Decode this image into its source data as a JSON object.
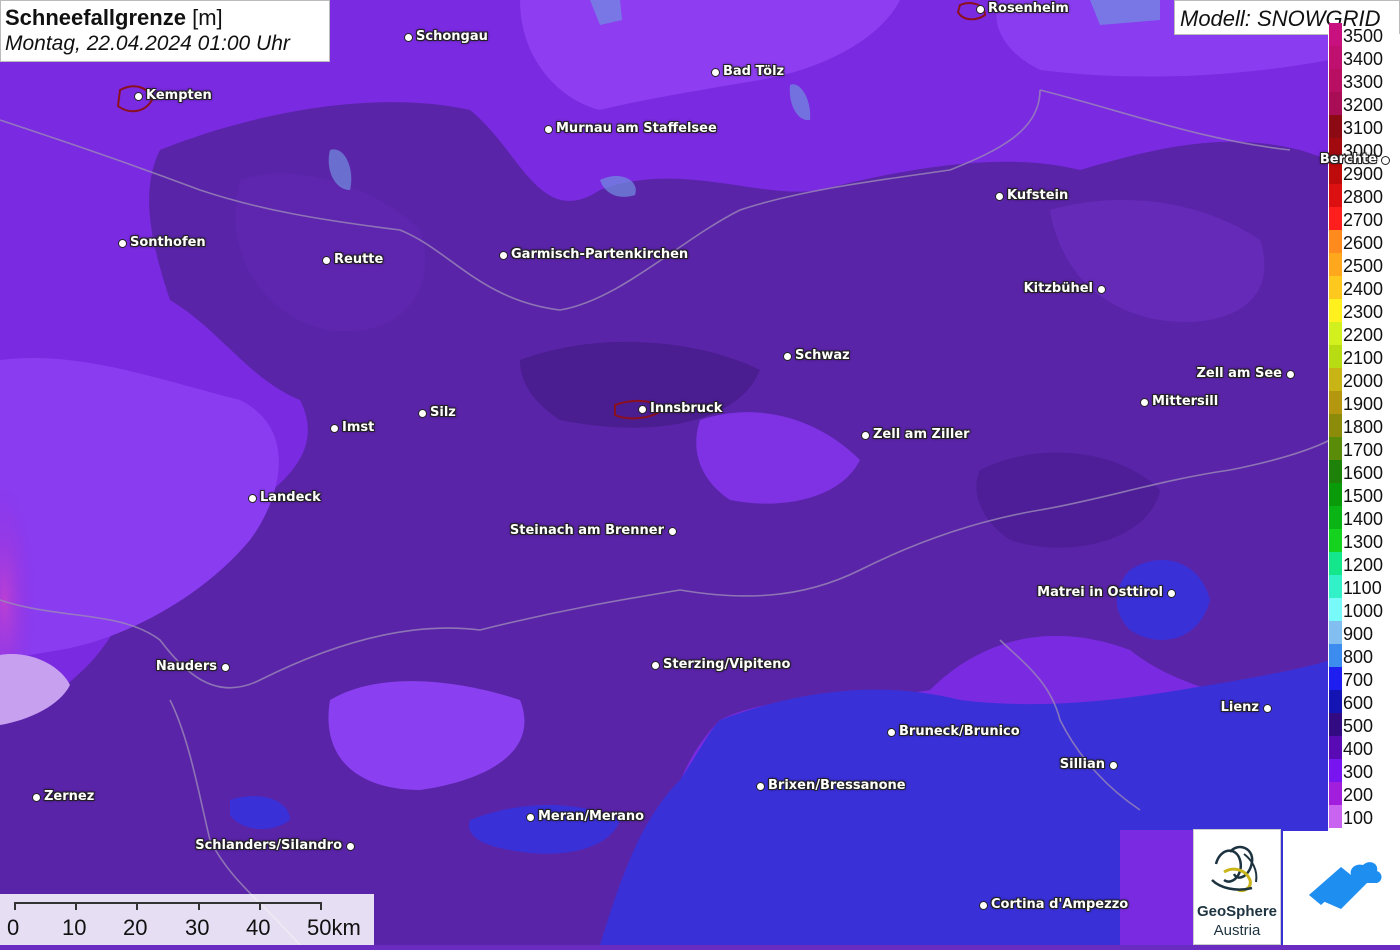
{
  "title": {
    "variable": "Schneefallgrenze",
    "unit": "[m]",
    "datetime": "Montag, 22.04.2024 01:00 Uhr"
  },
  "model": {
    "label": "Modell: SNOWGRID"
  },
  "legend": [
    {
      "value": "3500",
      "color": "#c8107e"
    },
    {
      "value": "3400",
      "color": "#c0106f"
    },
    {
      "value": "3300",
      "color": "#b80f62"
    },
    {
      "value": "3200",
      "color": "#a80d55"
    },
    {
      "value": "3100",
      "color": "#8c0a14"
    },
    {
      "value": "3000",
      "color": "#a20a10"
    },
    {
      "value": "2900",
      "color": "#bd0b0b"
    },
    {
      "value": "2800",
      "color": "#dc1010"
    },
    {
      "value": "2700",
      "color": "#ff1e1e"
    },
    {
      "value": "2600",
      "color": "#ff8a1e"
    },
    {
      "value": "2500",
      "color": "#ffa81e"
    },
    {
      "value": "2400",
      "color": "#ffc81e"
    },
    {
      "value": "2300",
      "color": "#fff01e"
    },
    {
      "value": "2200",
      "color": "#d2f01e"
    },
    {
      "value": "2100",
      "color": "#b8dc14"
    },
    {
      "value": "2000",
      "color": "#c8b414"
    },
    {
      "value": "1900",
      "color": "#b4960f"
    },
    {
      "value": "1800",
      "color": "#8c8c0a"
    },
    {
      "value": "1700",
      "color": "#5a8c0a"
    },
    {
      "value": "1600",
      "color": "#1e820a"
    },
    {
      "value": "1500",
      "color": "#0a9b0a"
    },
    {
      "value": "1400",
      "color": "#0ab414"
    },
    {
      "value": "1300",
      "color": "#14d21e"
    },
    {
      "value": "1200",
      "color": "#14e68c"
    },
    {
      "value": "1100",
      "color": "#32f0c8"
    },
    {
      "value": "1000",
      "color": "#78fafa"
    },
    {
      "value": "900",
      "color": "#82bef0"
    },
    {
      "value": "800",
      "color": "#3c8cf0"
    },
    {
      "value": "700",
      "color": "#1e1ef0"
    },
    {
      "value": "600",
      "color": "#1414b4"
    },
    {
      "value": "500",
      "color": "#320a82"
    },
    {
      "value": "400",
      "color": "#5a0ab4"
    },
    {
      "value": "300",
      "color": "#7814f0"
    },
    {
      "value": "200",
      "color": "#a01edc"
    },
    {
      "value": "100",
      "color": "#c864f0"
    }
  ],
  "cities": [
    {
      "name": "Rosenheim"
    },
    {
      "name": "Schongau"
    },
    {
      "name": "Kempten"
    },
    {
      "name": "Bad Tölz"
    },
    {
      "name": "Murnau am Staffelsee"
    },
    {
      "name": "Berchte"
    },
    {
      "name": "Kufstein"
    },
    {
      "name": "Sonthofen"
    },
    {
      "name": "Reutte"
    },
    {
      "name": "Garmisch-Partenkirchen"
    },
    {
      "name": "Kitzbühel"
    },
    {
      "name": "Schwaz"
    },
    {
      "name": "Zell am See"
    },
    {
      "name": "Mittersill"
    },
    {
      "name": "Innsbruck"
    },
    {
      "name": "Silz"
    },
    {
      "name": "Imst"
    },
    {
      "name": "Zell am Ziller"
    },
    {
      "name": "Landeck"
    },
    {
      "name": "Steinach am Brenner"
    },
    {
      "name": "Matrei in Osttirol"
    },
    {
      "name": "Nauders"
    },
    {
      "name": "Sterzing/Vipiteno"
    },
    {
      "name": "Lienz"
    },
    {
      "name": "Bruneck/Brunico"
    },
    {
      "name": "Sillian"
    },
    {
      "name": "Brixen/Bressanone"
    },
    {
      "name": "Zernez"
    },
    {
      "name": "Meran/Merano"
    },
    {
      "name": "Schlanders/Silandro"
    },
    {
      "name": "Cortina d'Ampezzo"
    }
  ],
  "scale_bar": {
    "labels": [
      "0",
      "10",
      "20",
      "30",
      "40",
      "50km"
    ]
  },
  "logos": {
    "geosphere_name": "GeoSphere",
    "geosphere_sub": "Austria"
  }
}
